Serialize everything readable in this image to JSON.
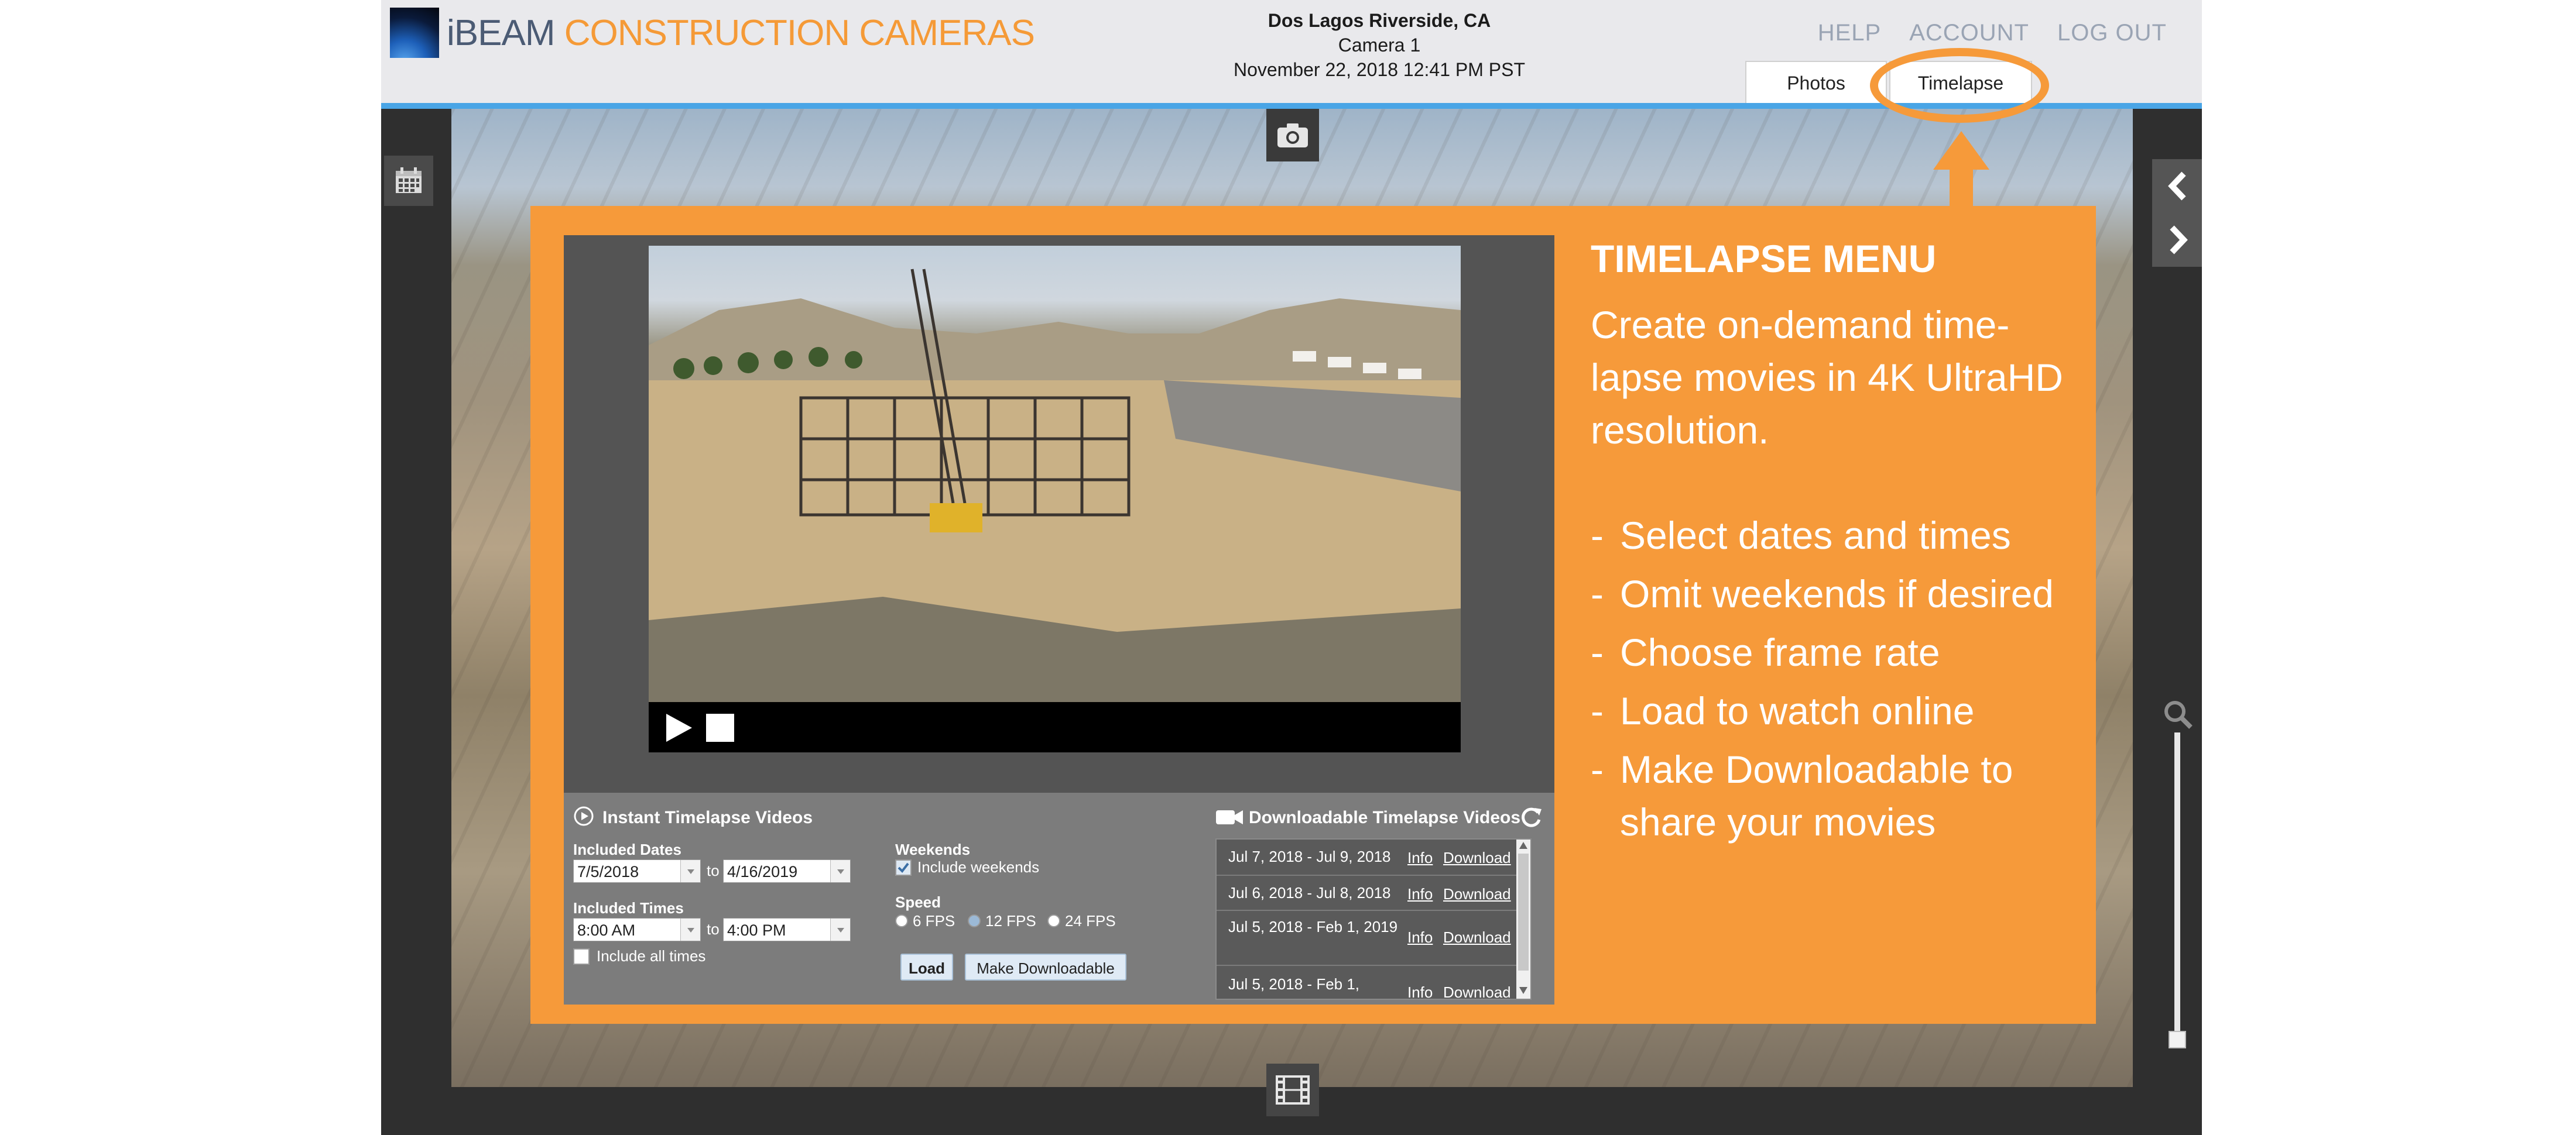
{
  "header": {
    "logo_brand": "iBEAM",
    "logo_rest": "CONSTRUCTION CAMERAS",
    "site": "Dos Lagos Riverside, CA",
    "camera": "Camera 1",
    "datetime": "November 22, 2018 12:41 PM PST",
    "nav": [
      "HELP",
      "ACCOUNT",
      "LOG OUT"
    ],
    "tabs": [
      "Photos",
      "Timelapse"
    ]
  },
  "instant": {
    "title": "Instant Timelapse Videos",
    "included_dates_label": "Included Dates",
    "date_from": "7/5/2018",
    "date_to": "4/16/2019",
    "to_label": "to",
    "included_times_label": "Included Times",
    "time_from": "8:00 AM",
    "time_to": "4:00 PM",
    "include_all_times": "Include all times",
    "weekends_label": "Weekends",
    "include_weekends": "Include weekends",
    "speed_label": "Speed",
    "speed_options": [
      "6 FPS",
      "12 FPS",
      "24 FPS"
    ],
    "load_label": "Load",
    "make_downloadable_label": "Make Downloadable"
  },
  "downloadable": {
    "title": "Downloadable Timelapse Videos",
    "info_label": "Info",
    "download_label": "Download",
    "items": [
      {
        "range": "Jul 7, 2018 - Jul 9, 2018"
      },
      {
        "range": "Jul 6, 2018 - Jul 8, 2018"
      },
      {
        "range": "Jul 5, 2018 - Feb 1, 2019"
      },
      {
        "range": "Jul 5, 2018 - Feb 1,"
      }
    ]
  },
  "callout": {
    "title": "TIMELAPSE MENU",
    "description": "Create on-demand time-lapse movies in 4K UltraHD resolution.",
    "bullets": [
      "Select dates and times",
      "Omit weekends if desired",
      "Choose frame rate",
      "Load to watch online",
      "Make Downloadable to share your movies"
    ]
  },
  "colors": {
    "accent_orange": "#f69a3a",
    "header_blue_rule": "#49a5e6",
    "logo_orange": "#f59a37"
  }
}
